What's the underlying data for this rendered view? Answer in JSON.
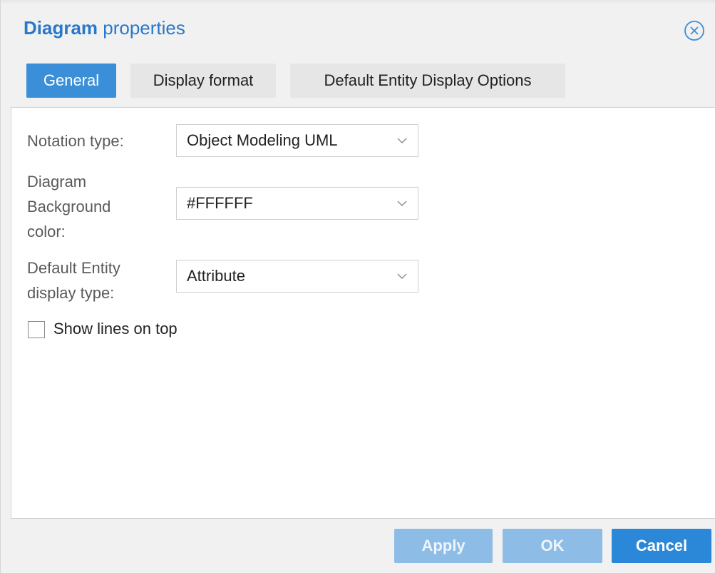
{
  "dialog": {
    "title_bold": "Diagram",
    "title_rest": " properties"
  },
  "tabs": [
    {
      "label": "General",
      "active": true
    },
    {
      "label": "Display format",
      "active": false
    },
    {
      "label": "Default Entity Display Options",
      "active": false
    }
  ],
  "form": {
    "notation_label": "Notation type:",
    "notation_value": "Object Modeling UML",
    "bg_label_line1": "Diagram",
    "bg_label_line2": "Background",
    "bg_label_line3": "color:",
    "bg_value": "#FFFFFF",
    "entity_label_line1": "Default Entity",
    "entity_label_line2": "display type:",
    "entity_value": "Attribute",
    "show_lines_label": "Show lines on top",
    "show_lines_checked": false
  },
  "footer": {
    "apply_label": "Apply",
    "ok_label": "OK",
    "cancel_label": "Cancel"
  },
  "colors": {
    "accent": "#2b88d8",
    "title": "#2a78c9",
    "disabled_button": "#8dbde6"
  }
}
